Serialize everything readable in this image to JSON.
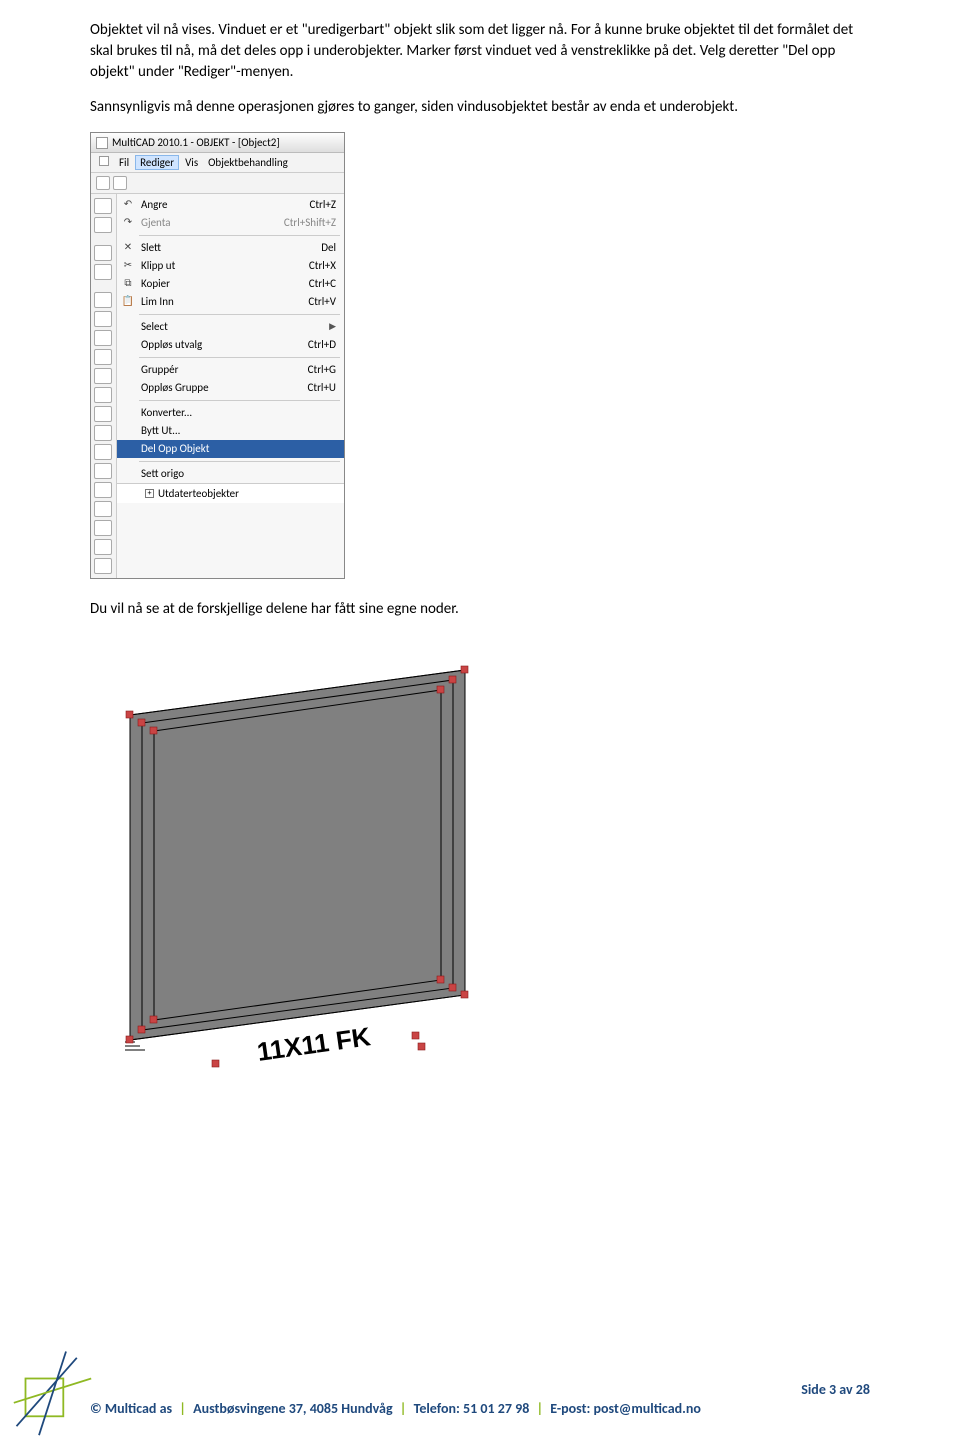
{
  "paragraphs": {
    "p1": "Objektet vil nå vises. Vinduet er et \"uredigerbart\" objekt slik som det ligger nå. For å kunne bruke objektet til det formålet det skal brukes til nå, må det deles opp i underobjekter. Marker først vinduet ved å venstreklikke på det. Velg deretter \"Del opp objekt\" under \"Rediger\"-menyen.",
    "p2": "Sannsynligvis må denne operasjonen gjøres to ganger, siden vindusobjektet består av enda et underobjekt.",
    "p3": "Du vil nå se at de forskjellige delene har fått sine egne noder."
  },
  "screenshot": {
    "title": "MultiCAD 2010.1 - OBJEKT - [Object2]",
    "menus": {
      "fil": "Fil",
      "rediger": "Rediger",
      "vis": "Vis",
      "objektbehandling": "Objektbehandling"
    },
    "items": {
      "angre": {
        "label": "Angre",
        "shortcut": "Ctrl+Z"
      },
      "gjenta": {
        "label": "Gjenta",
        "shortcut": "Ctrl+Shift+Z"
      },
      "slett": {
        "label": "Slett",
        "shortcut": "Del"
      },
      "klipput": {
        "label": "Klipp ut",
        "shortcut": "Ctrl+X"
      },
      "kopier": {
        "label": "Kopier",
        "shortcut": "Ctrl+C"
      },
      "liminn": {
        "label": "Lim Inn",
        "shortcut": "Ctrl+V"
      },
      "select": {
        "label": "Select",
        "shortcut": ""
      },
      "opplosutv": {
        "label": "Oppløs utvalg",
        "shortcut": "Ctrl+D"
      },
      "grupper": {
        "label": "Gruppér",
        "shortcut": "Ctrl+G"
      },
      "opplosgrp": {
        "label": "Oppløs Gruppe",
        "shortcut": "Ctrl+U"
      },
      "konverter": {
        "label": "Konverter...",
        "shortcut": ""
      },
      "byttut": {
        "label": "Bytt Ut...",
        "shortcut": ""
      },
      "delopp": {
        "label": "Del Opp Objekt",
        "shortcut": ""
      },
      "settorigo": {
        "label": "Sett origo",
        "shortcut": ""
      }
    },
    "tree": "Utdaterteobjekter"
  },
  "drawing": {
    "label": "11X11 FK"
  },
  "footer": {
    "page": "Side 3 av 28",
    "company": "© Multicad as",
    "address": "Austbøsvingene 37, 4085 Hundvåg",
    "phone": "Telefon: 51 01 27 98",
    "email": "E-post: post@multicad.no"
  }
}
